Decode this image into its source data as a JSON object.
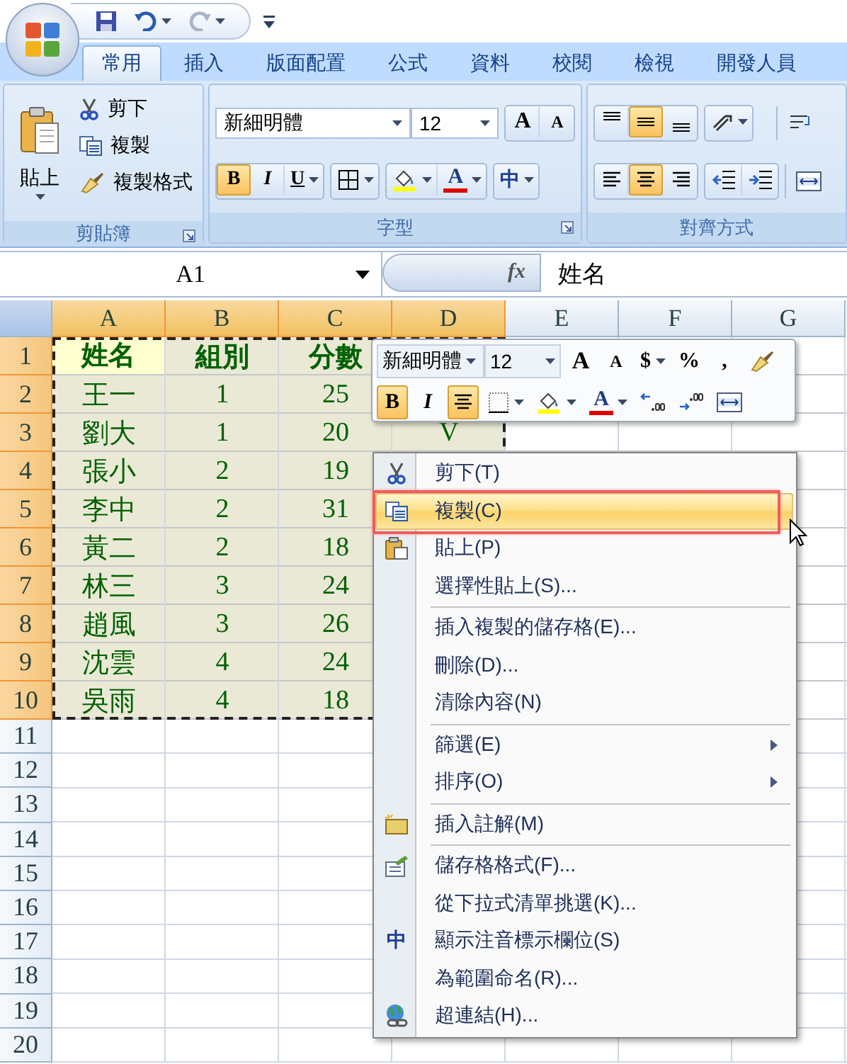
{
  "tabs": [
    {
      "label": "常用",
      "selected": true
    },
    {
      "label": "插入",
      "selected": false
    },
    {
      "label": "版面配置",
      "selected": false
    },
    {
      "label": "公式",
      "selected": false
    },
    {
      "label": "資料",
      "selected": false
    },
    {
      "label": "校閱",
      "selected": false
    },
    {
      "label": "檢視",
      "selected": false
    },
    {
      "label": "開發人員",
      "selected": false
    }
  ],
  "ribbon": {
    "clipboard": {
      "title": "剪貼簿",
      "paste": "貼上",
      "small": [
        "剪下",
        "複製",
        "複製格式"
      ]
    },
    "font": {
      "title": "字型",
      "font_name": "新細明體",
      "font_size": "12",
      "grow": "A",
      "shrink": "A",
      "bold": {
        "label": "B",
        "pressed": true
      },
      "italic": {
        "label": "I",
        "pressed": false
      },
      "underline": {
        "label": "U",
        "pressed": false
      },
      "font_color": "A",
      "phonetic": "中"
    },
    "alignment": {
      "title": "對齊方式",
      "vertical": [
        {
          "selected": false
        },
        {
          "selected": true
        },
        {
          "selected": false
        }
      ],
      "horizontal": [
        {
          "selected": false
        },
        {
          "selected": true
        },
        {
          "selected": false
        }
      ]
    }
  },
  "formula_bar": {
    "name_box": "A1",
    "fx": "fx",
    "content": "姓名"
  },
  "sheet": {
    "marquee": true,
    "columns": [
      {
        "label": "A",
        "selected": true
      },
      {
        "label": "B",
        "selected": true
      },
      {
        "label": "C",
        "selected": true
      },
      {
        "label": "D",
        "selected": true
      },
      {
        "label": "E",
        "selected": false
      },
      {
        "label": "F",
        "selected": false
      },
      {
        "label": "G",
        "selected": false
      }
    ],
    "rows": [
      {
        "label": "1",
        "kind": "header",
        "selected": true,
        "active": true,
        "cells": [
          "姓名",
          "組別",
          "分數"
        ]
      },
      {
        "label": "2",
        "kind": "data",
        "selected": true,
        "active": false,
        "cells": [
          "王一",
          "1",
          "25"
        ]
      },
      {
        "label": "3",
        "kind": "data",
        "selected": true,
        "active": false,
        "cells": [
          "劉大",
          "1",
          "20",
          "V"
        ]
      },
      {
        "label": "4",
        "kind": "data",
        "selected": true,
        "active": false,
        "cells": [
          "張小",
          "2",
          "19"
        ]
      },
      {
        "label": "5",
        "kind": "data",
        "selected": true,
        "active": false,
        "cells": [
          "李中",
          "2",
          "31"
        ]
      },
      {
        "label": "6",
        "kind": "data",
        "selected": true,
        "active": false,
        "cells": [
          "黃二",
          "2",
          "18"
        ]
      },
      {
        "label": "7",
        "kind": "data",
        "selected": true,
        "active": false,
        "cells": [
          "林三",
          "3",
          "24"
        ]
      },
      {
        "label": "8",
        "kind": "data",
        "selected": true,
        "active": false,
        "cells": [
          "趙風",
          "3",
          "26"
        ]
      },
      {
        "label": "9",
        "kind": "data",
        "selected": true,
        "active": false,
        "cells": [
          "沈雲",
          "4",
          "24"
        ]
      },
      {
        "label": "10",
        "kind": "data",
        "selected": true,
        "active": false,
        "cells": [
          "吳雨",
          "4",
          "18"
        ]
      },
      {
        "label": "11",
        "kind": "empty",
        "selected": false
      },
      {
        "label": "12",
        "kind": "empty",
        "selected": false
      },
      {
        "label": "13",
        "kind": "empty",
        "selected": false
      },
      {
        "label": "14",
        "kind": "empty",
        "selected": false
      },
      {
        "label": "15",
        "kind": "empty",
        "selected": false
      },
      {
        "label": "16",
        "kind": "empty",
        "selected": false
      },
      {
        "label": "17",
        "kind": "empty",
        "selected": false
      },
      {
        "label": "18",
        "kind": "empty",
        "selected": false
      },
      {
        "label": "19",
        "kind": "empty",
        "selected": false
      },
      {
        "label": "20",
        "kind": "empty",
        "selected": false
      }
    ]
  },
  "mini_toolbar": {
    "font_name": "新細明體",
    "font_size": "12",
    "grow": "A",
    "shrink": "A",
    "currency": "$",
    "percent": "%",
    "comma": ",",
    "bold": {
      "label": "B",
      "pressed": true
    },
    "italic": {
      "label": "I",
      "pressed": false
    },
    "center": {
      "pressed": true
    },
    "font_color": "A"
  },
  "context_menu": {
    "highlight_box": true,
    "items": [
      {
        "label": "剪下(T)",
        "selected": false,
        "submenu": false,
        "separator_above": false
      },
      {
        "label": "複製(C)",
        "selected": true,
        "submenu": false,
        "separator_above": false
      },
      {
        "label": "貼上(P)",
        "selected": false,
        "submenu": false,
        "separator_above": false
      },
      {
        "label": "選擇性貼上(S)...",
        "selected": false,
        "submenu": false,
        "separator_above": false
      },
      {
        "label": "插入複製的儲存格(E)...",
        "selected": false,
        "submenu": false,
        "separator_above": true
      },
      {
        "label": "刪除(D)...",
        "selected": false,
        "submenu": false,
        "separator_above": false
      },
      {
        "label": "清除內容(N)",
        "selected": false,
        "submenu": false,
        "separator_above": false
      },
      {
        "label": "篩選(E)",
        "selected": false,
        "submenu": true,
        "separator_above": true
      },
      {
        "label": "排序(O)",
        "selected": false,
        "submenu": true,
        "separator_above": false
      },
      {
        "label": "插入註解(M)",
        "selected": false,
        "submenu": false,
        "separator_above": true
      },
      {
        "label": "儲存格格式(F)...",
        "selected": false,
        "submenu": false,
        "separator_above": true
      },
      {
        "label": "從下拉式清單挑選(K)...",
        "selected": false,
        "submenu": false,
        "separator_above": false
      },
      {
        "label": "顯示注音標示欄位(S)",
        "selected": false,
        "submenu": false,
        "separator_above": false,
        "glyph": "中"
      },
      {
        "label": "為範圍命名(R)...",
        "selected": false,
        "submenu": false,
        "separator_above": false
      },
      {
        "label": "超連結(H)...",
        "selected": false,
        "submenu": false,
        "separator_above": false
      }
    ]
  }
}
